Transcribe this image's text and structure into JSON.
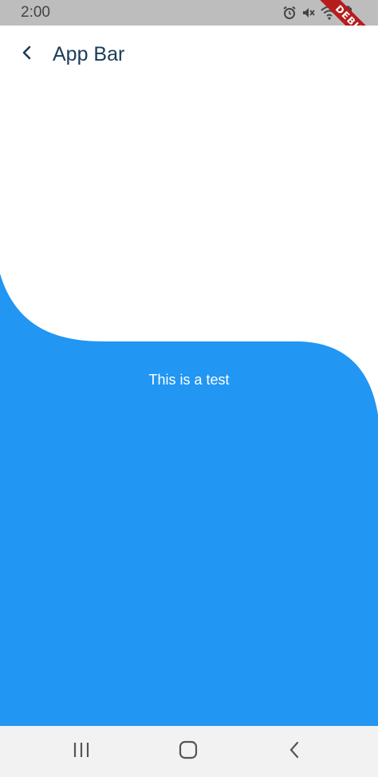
{
  "status_bar": {
    "time": "2:00",
    "icons": [
      "alarm-icon",
      "mute-icon",
      "wifi-icon",
      "battery-icon"
    ]
  },
  "debug_banner": "DEBUG",
  "app_bar": {
    "title": "App Bar",
    "back_icon": "chevron-left-icon"
  },
  "content": {
    "text": "This is a test"
  },
  "navigation": {
    "icons": [
      "recents-icon",
      "home-icon",
      "back-icon"
    ]
  },
  "colors": {
    "primary_blue": "#2196F3",
    "title_text": "#1B3B5A",
    "status_bar_bg": "#BDBDBD",
    "nav_bar_bg": "#F2F2F2",
    "debug_red": "#B71C1C"
  }
}
